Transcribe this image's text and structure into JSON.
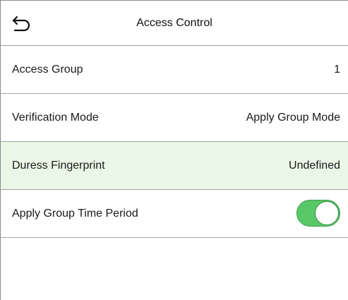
{
  "header": {
    "title": "Access Control",
    "back_icon": "back-arrow-icon"
  },
  "rows": [
    {
      "label": "Access Group",
      "value": "1"
    },
    {
      "label": "Verification Mode",
      "value": "Apply Group Mode"
    },
    {
      "label": "Duress Fingerprint",
      "value": "Undefined",
      "highlighted": true
    },
    {
      "label": "Apply Group Time Period",
      "toggle_on": true
    }
  ],
  "colors": {
    "highlight_row": "#eaf6e6",
    "toggle_on": "#58c767"
  }
}
